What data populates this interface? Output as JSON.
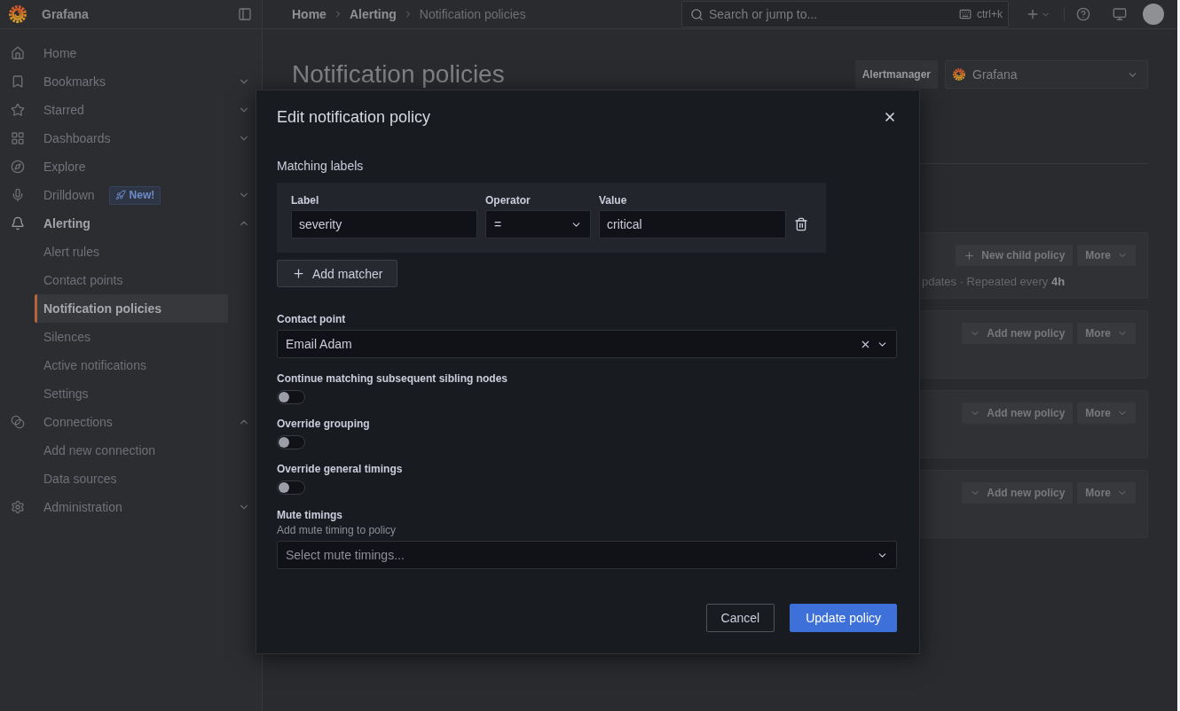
{
  "sidebar": {
    "brand": "Grafana",
    "items": [
      {
        "label": "Home",
        "selected": false
      },
      {
        "label": "Bookmarks",
        "selected": false,
        "expanded": false
      },
      {
        "label": "Starred",
        "selected": false,
        "expanded": false
      },
      {
        "label": "Dashboards",
        "selected": false,
        "expanded": false
      },
      {
        "label": "Explore",
        "selected": false
      },
      {
        "label": "Drilldown",
        "selected": false,
        "expanded": false,
        "badge": "New!"
      },
      {
        "label": "Alerting",
        "selected": true,
        "expanded": true,
        "children": [
          {
            "label": "Alert rules",
            "selected": false
          },
          {
            "label": "Contact points",
            "selected": false
          },
          {
            "label": "Notification policies",
            "selected": true
          },
          {
            "label": "Silences",
            "selected": false
          },
          {
            "label": "Active notifications",
            "selected": false
          },
          {
            "label": "Settings",
            "selected": false
          }
        ]
      },
      {
        "label": "Connections",
        "selected": false,
        "expanded": true,
        "children": [
          {
            "label": "Add new connection",
            "selected": false
          },
          {
            "label": "Data sources",
            "selected": false
          }
        ]
      },
      {
        "label": "Administration",
        "selected": false,
        "expanded": false
      }
    ]
  },
  "topbar": {
    "breadcrumbs": [
      "Home",
      "Alerting",
      "Notification policies"
    ],
    "search": {
      "placeholder": "Search or jump to...",
      "shortcut": "ctrl+k"
    }
  },
  "page": {
    "title": "Notification policies",
    "alertmanager": {
      "label": "Alertmanager",
      "value": "Grafana"
    }
  },
  "policies": [
    {
      "actions": [
        {
          "kind": "create",
          "label": "New child policy"
        },
        {
          "kind": "menu",
          "label": "More"
        }
      ],
      "meta": "pdates · Repeated every **4h**"
    },
    {
      "actions": [
        {
          "kind": "expand",
          "label": "Add new policy"
        },
        {
          "kind": "menu",
          "label": "More"
        }
      ]
    },
    {
      "actions": [
        {
          "kind": "expand",
          "label": "Add new policy"
        },
        {
          "kind": "menu",
          "label": "More"
        }
      ]
    },
    {
      "actions": [
        {
          "kind": "expand",
          "label": "Add new policy"
        },
        {
          "kind": "menu",
          "label": "More"
        }
      ]
    }
  ],
  "modal": {
    "title": "Edit notification policy",
    "matching_labels": {
      "title": "Matching labels",
      "columns": [
        "Label",
        "Operator",
        "Value"
      ],
      "matchers": [
        {
          "label": "severity",
          "operator": "=",
          "value": "critical"
        }
      ],
      "add_button": "Add matcher"
    },
    "contact_point": {
      "label": "Contact point",
      "value": "Email Adam"
    },
    "toggles": [
      {
        "label": "Continue matching subsequent sibling nodes",
        "on": false
      },
      {
        "label": "Override grouping",
        "on": false
      },
      {
        "label": "Override general timings",
        "on": false
      }
    ],
    "mute_timings": {
      "label": "Mute timings",
      "description": "Add mute timing to policy",
      "placeholder": "Select mute timings..."
    },
    "buttons": [
      {
        "kind": "secondary",
        "label": "Cancel"
      },
      {
        "kind": "primary",
        "label": "Update policy"
      }
    ]
  }
}
